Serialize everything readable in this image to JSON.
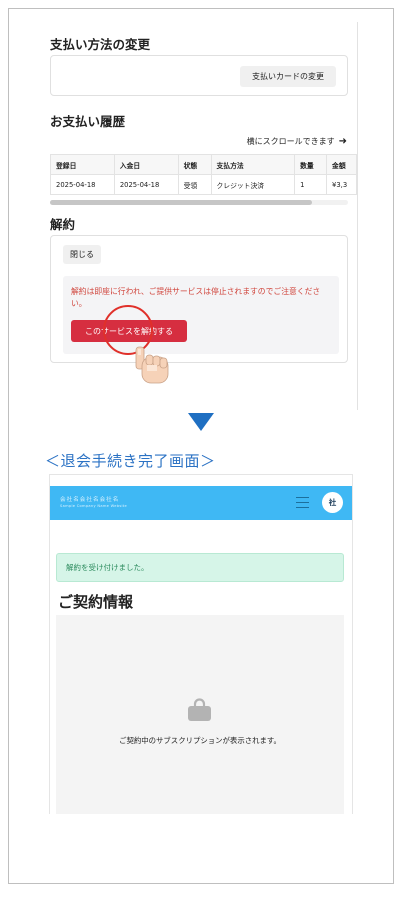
{
  "top": {
    "payment_method": {
      "title": "支払い方法の変更",
      "change_card_label": "支払いカードの変更"
    },
    "history": {
      "title": "お支払い履歴",
      "scroll_hint": "横にスクロールできます",
      "columns": [
        "登録日",
        "入金日",
        "状態",
        "支払方法",
        "数量",
        "金額"
      ],
      "rows": [
        [
          "2025-04-18",
          "2025-04-18",
          "受領",
          "クレジット決済",
          "1",
          "¥3,3"
        ]
      ]
    },
    "cancellation": {
      "title": "解約",
      "close_label": "閉じる",
      "warning": "解約は即座に行われ、ご提供サービスは停止されますのでご注意ください。",
      "cancel_button_label": "このサービスを解約する"
    }
  },
  "section_caption": "＜退会手続き完了画面＞",
  "bottom": {
    "app_bar": {
      "logo_text": "会社名会社名会社名",
      "logo_subtext": "Sample Company Name Website",
      "avatar_label": "社"
    },
    "toast": "解約を受け付けました。",
    "contract_title": "ご契約情報",
    "empty_message": "ご契約中のサブスクリプションが表示されます。"
  },
  "colors": {
    "accent_blue": "#1f6fc2",
    "app_bar": "#3fb8f4",
    "danger": "#d62e40",
    "warning_text": "#d0453c",
    "success_bg": "#d6f5e8",
    "success_text": "#2a8a5c"
  }
}
